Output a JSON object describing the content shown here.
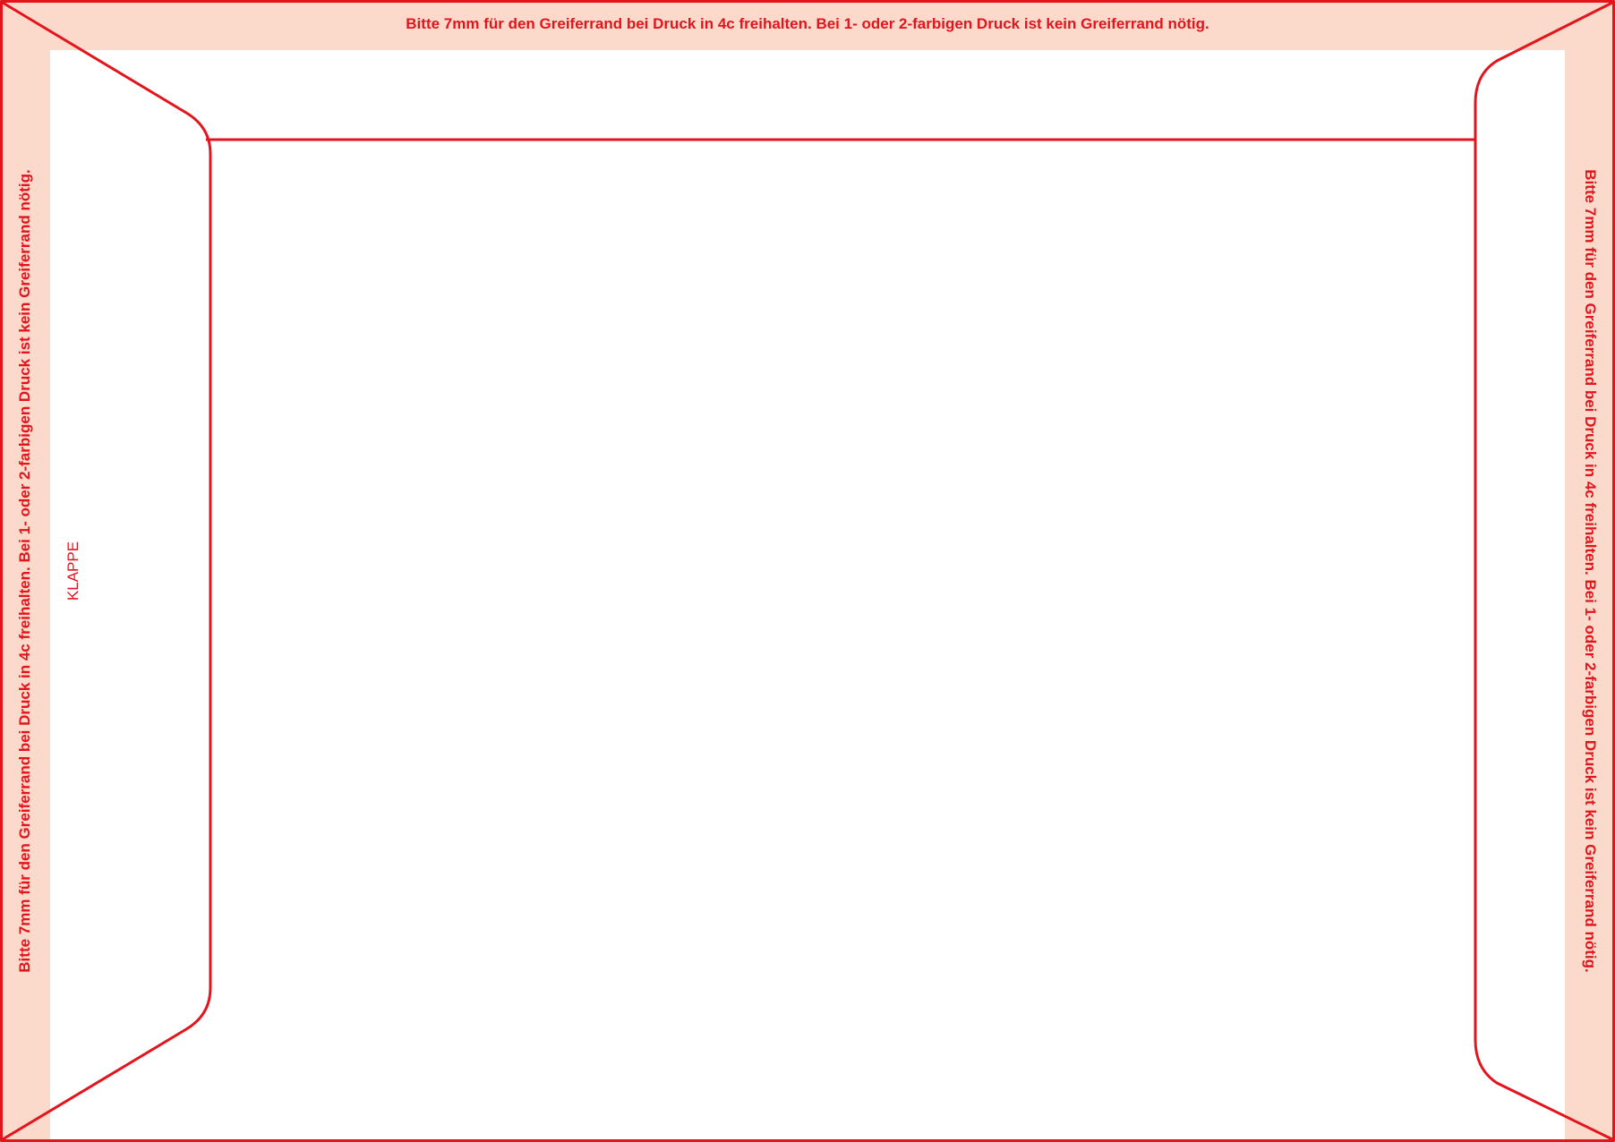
{
  "margin_notes": {
    "top": "Bitte 7mm für den Greiferrand bei Druck in 4c freihalten. Bei 1- oder 2-farbigen Druck ist kein Greiferrand nötig.",
    "left": "Bitte 7mm für den Greiferrand bei Druck in 4c freihalten. Bei 1- oder 2-farbigen Druck ist kein Greiferrand nötig.",
    "right": "Bitte 7mm für den Greiferrand bei Druck in 4c freihalten. Bei 1- oder 2-farbigen Druck ist kein Greiferrand nötig."
  },
  "flap_label": "KLAPPE",
  "colors": {
    "line": "#e3141c",
    "gripper_margin": "#fbd9cb",
    "paper": "#ffffff"
  }
}
